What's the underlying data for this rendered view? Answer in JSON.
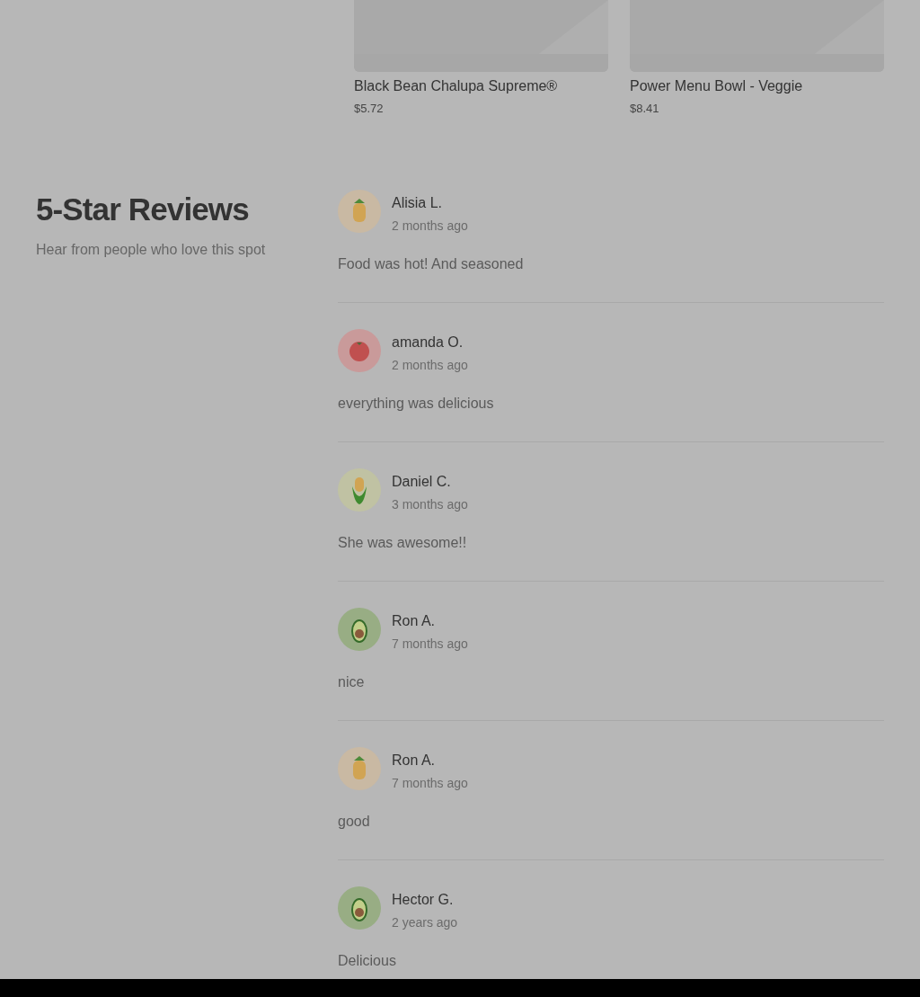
{
  "menu_items": [
    {
      "name": "Black Bean Chalupa Supreme®",
      "price": "$5.72"
    },
    {
      "name": "Power Menu Bowl - Veggie",
      "price": "$8.41"
    }
  ],
  "reviews_section": {
    "title": "5-Star Reviews",
    "subtitle": "Hear from people who love this spot",
    "reviews": [
      {
        "name": "Alisia L.",
        "time": "2 months ago",
        "text": "Food was hot! And seasoned",
        "kind": "pineapple"
      },
      {
        "name": "amanda O.",
        "time": "2 months ago",
        "text": "everything was delicious",
        "kind": "tomato"
      },
      {
        "name": "Daniel C.",
        "time": "3 months ago",
        "text": "She was awesome!!",
        "kind": "corn"
      },
      {
        "name": "Ron A.",
        "time": "7 months ago",
        "text": "nice",
        "kind": "avocado"
      },
      {
        "name": "Ron A.",
        "time": "7 months ago",
        "text": "good",
        "kind": "pineapple"
      },
      {
        "name": "Hector G.",
        "time": "2 years ago",
        "text": "Delicious",
        "kind": "avocado"
      }
    ]
  }
}
